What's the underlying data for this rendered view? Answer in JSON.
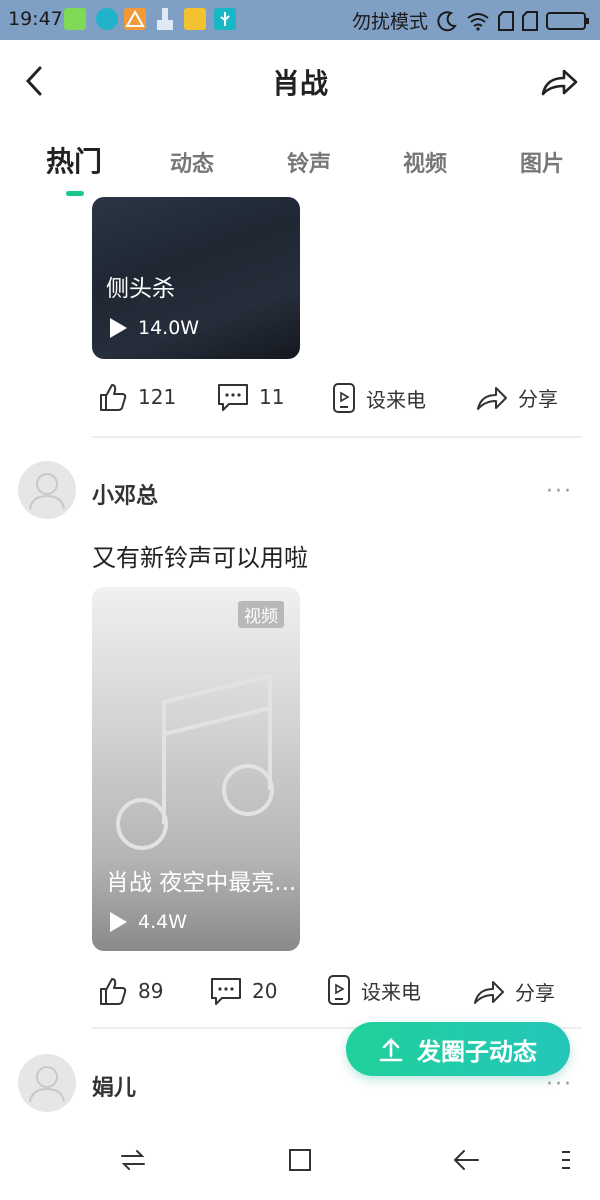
{
  "status_bar": {
    "time": "19:47",
    "dnd_text": "勿扰模式",
    "icons": [
      "android-icon",
      "sync-icon",
      "warning-icon",
      "broom-icon",
      "folder-icon",
      "usb-icon",
      "moon-icon",
      "wifi-icon",
      "sim1-icon",
      "sim2-icon",
      "battery-icon"
    ]
  },
  "header": {
    "title": "肖战",
    "back_icon": "back-arrow-icon",
    "share_icon": "share-icon"
  },
  "tabs": [
    {
      "label": "热门",
      "active": true
    },
    {
      "label": "动态",
      "active": false
    },
    {
      "label": "铃声",
      "active": false
    },
    {
      "label": "视频",
      "active": false
    },
    {
      "label": "图片",
      "active": false
    }
  ],
  "accent_color": "#19c58f",
  "posts": [
    {
      "thumb_title": "侧头杀",
      "plays": "14.0W",
      "likes": "121",
      "comments": "11",
      "set_ringtone": "设来电",
      "share": "分享"
    },
    {
      "user": "小邓总",
      "more": "···",
      "text": "又有新铃声可以用啦",
      "badge": "视频",
      "thumb_title": "肖战 夜空中最亮...",
      "plays": "4.4W",
      "likes": "89",
      "comments": "20",
      "set_ringtone": "设来电",
      "share": "分享"
    },
    {
      "user": "娟儿",
      "more": "···"
    }
  ],
  "fab": {
    "label": "发圈子动态"
  },
  "nav_bar": [
    "switch-icon",
    "home-square-icon",
    "back-icon",
    "menu-icon"
  ]
}
